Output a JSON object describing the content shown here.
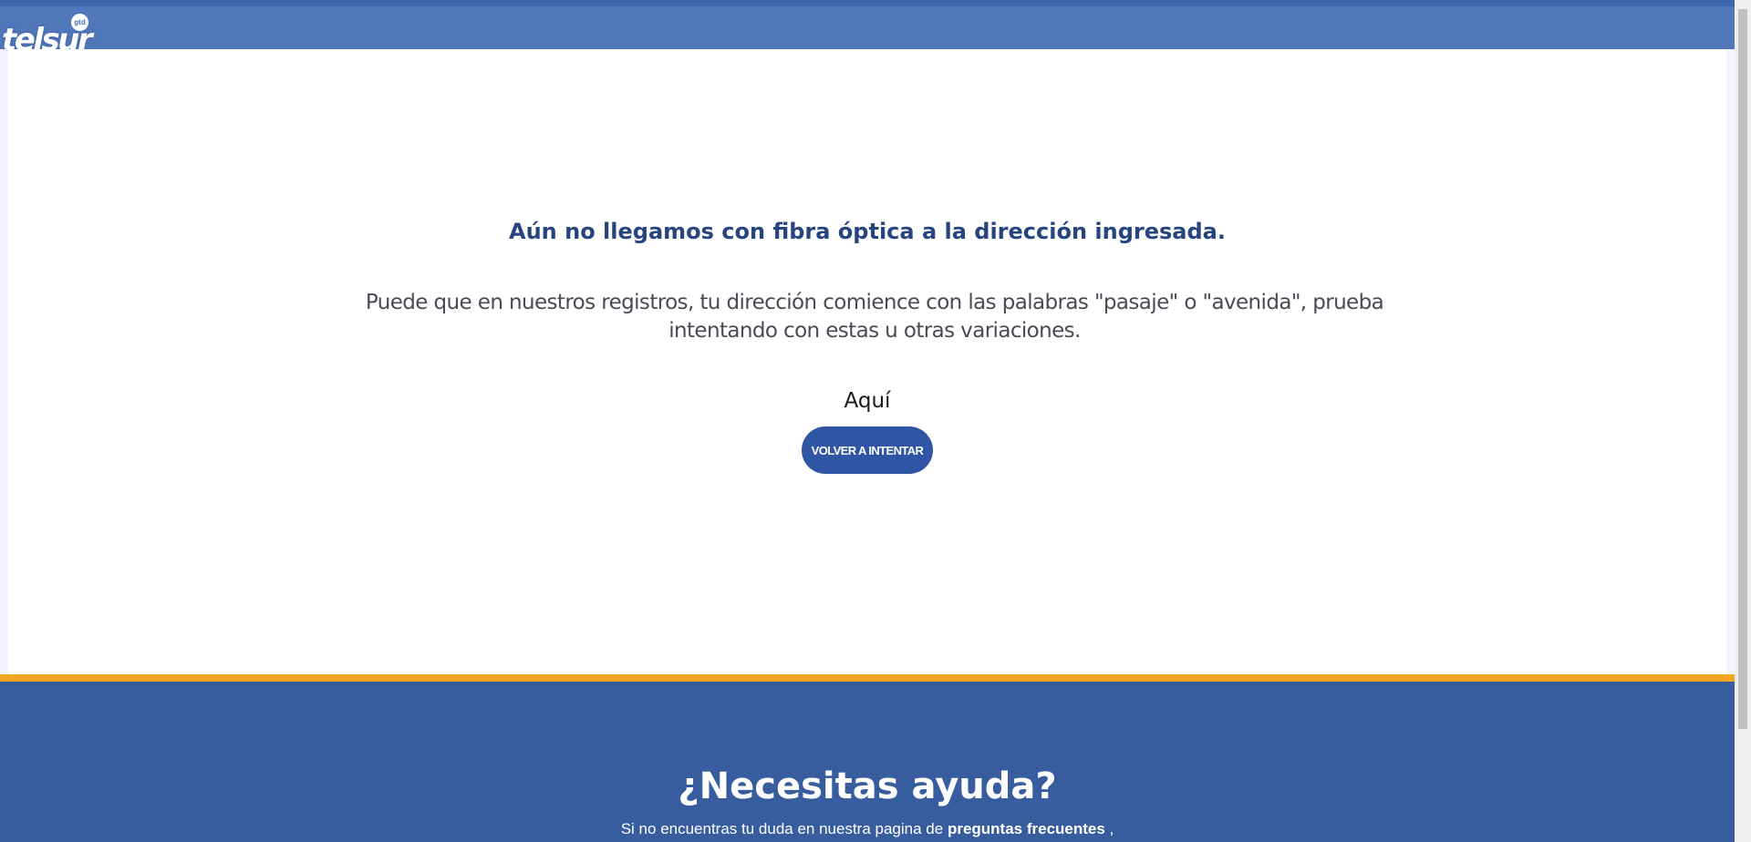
{
  "header": {
    "logo_text": "telsur",
    "logo_badge": "gtd"
  },
  "main": {
    "headline": "Aún no llegamos con fibra óptica a la dirección ingresada.",
    "description": "Puede que en nuestros registros, tu dirección comience con las palabras \"pasaje\" o \"avenida\", prueba intentando con estas u otras variaciones.",
    "aqui_label": "Aquí",
    "retry_button": "VOLVER A INTENTAR"
  },
  "footer": {
    "help_title": "¿Necesitas ayuda?",
    "help_text_prefix": "Si no encuentras tu duda en nuestra pagina de ",
    "faq_link": "preguntas frecuentes",
    "help_text_suffix": " ,"
  },
  "colors": {
    "header_bg": "#5177bb",
    "headline": "#26457e",
    "button_bg": "#2f55a4",
    "accent_strip": "#f4a622",
    "footer_bg": "#385d9e"
  }
}
